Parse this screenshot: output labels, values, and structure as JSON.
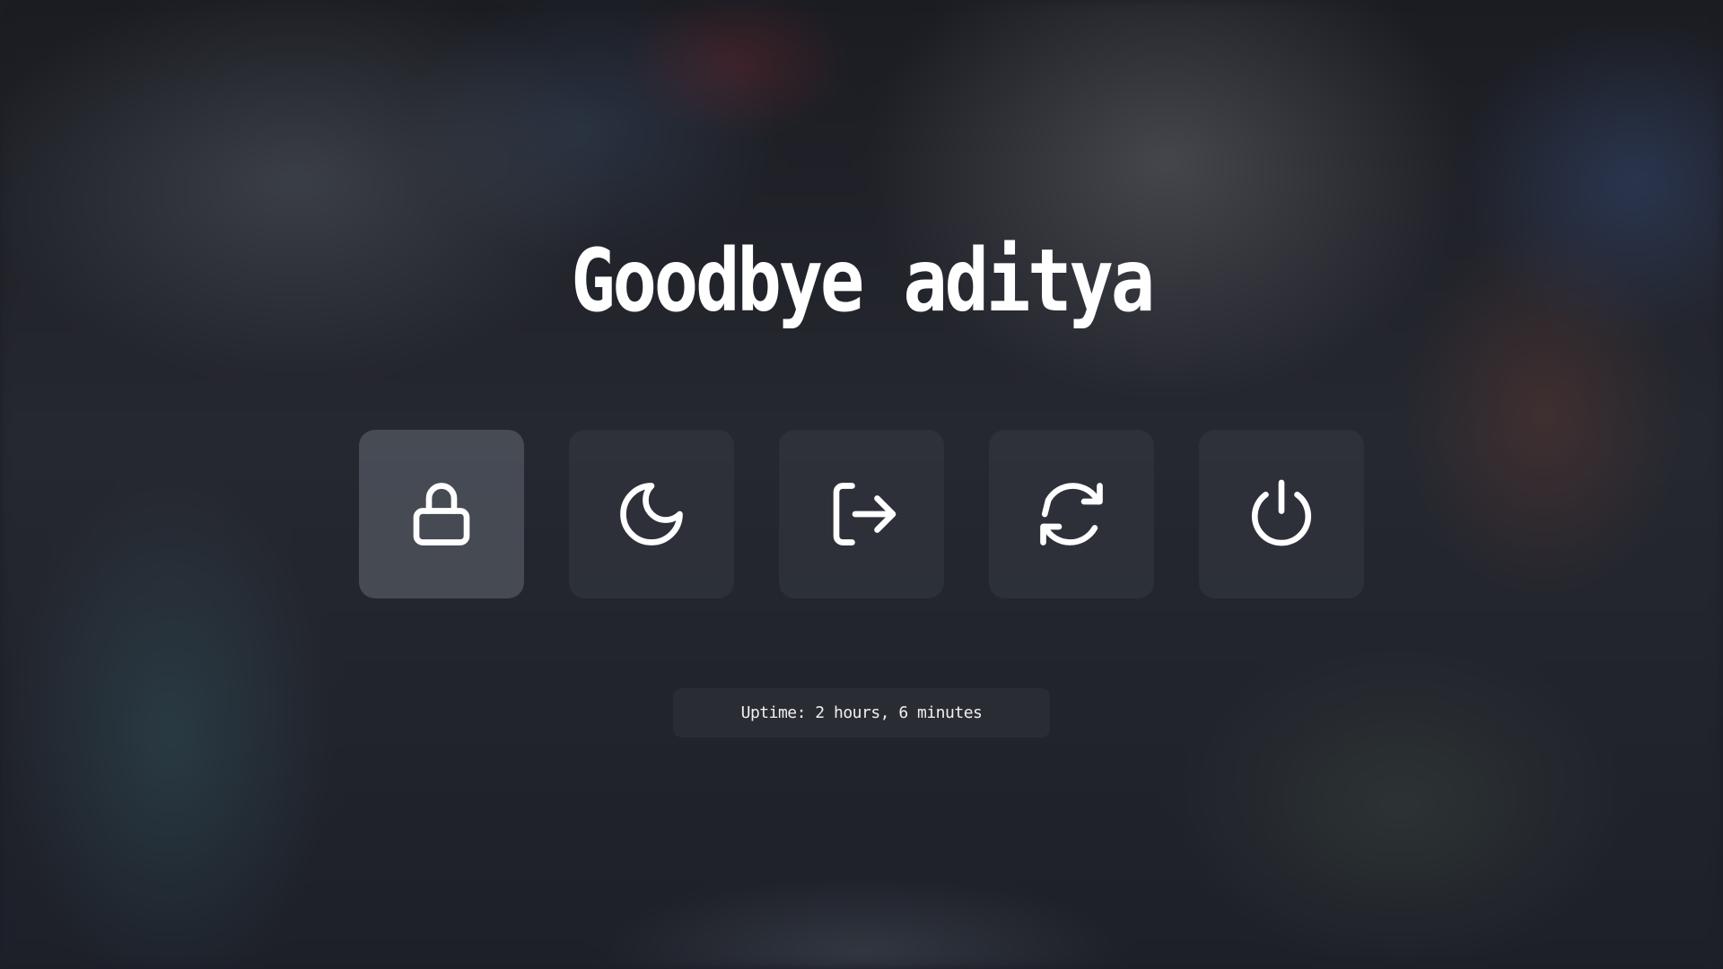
{
  "greeting": "Goodbye aditya",
  "actions": [
    {
      "id": "lock",
      "icon": "lock-icon",
      "selected": true
    },
    {
      "id": "suspend",
      "icon": "moon-icon",
      "selected": false
    },
    {
      "id": "logout",
      "icon": "logout-icon",
      "selected": false
    },
    {
      "id": "reboot",
      "icon": "reboot-icon",
      "selected": false
    },
    {
      "id": "shutdown",
      "icon": "power-icon",
      "selected": false
    }
  ],
  "uptime": "Uptime: 2 hours, 6 minutes",
  "colors": {
    "text": "#ffffff",
    "button": "#343842",
    "button_selected": "#5c626c",
    "background": "#1c1e26"
  }
}
